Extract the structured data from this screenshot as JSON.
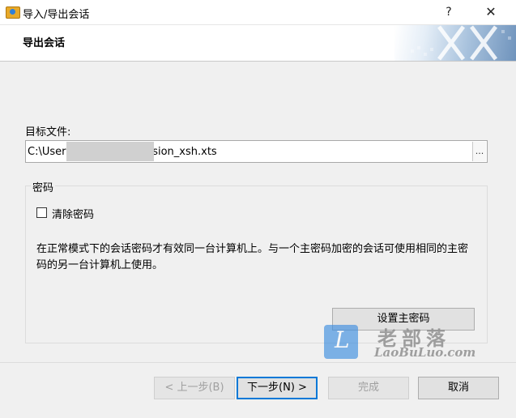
{
  "window": {
    "title": "导入/导出会话",
    "help_label": "?",
    "close_label": "✕",
    "icon": "xshell-folder-icon"
  },
  "header": {
    "title": "导出会话"
  },
  "target": {
    "label": "目标文件:",
    "value_prefix": "C:\\Users",
    "value_suffix": "op\\session_xsh.xts",
    "browse_label": "..."
  },
  "password": {
    "legend": "密码",
    "checkbox_label": "清除密码",
    "checked": false,
    "description": "在正常模式下的会话密码才有效同一台计算机上。与一个主密码加密的会话可使用相同的主密码的另一台计算机上使用。",
    "set_master_label": "设置主密码"
  },
  "watermark": {
    "logo_glyph": "L",
    "cn": "老部落",
    "en": "LaoBuLuo.com"
  },
  "footer": {
    "back_label": "< 上一步(B)",
    "next_label": "下一步(N) >",
    "finish_label": "完成",
    "cancel_label": "取消"
  },
  "colors": {
    "window_bg": "#f0f0f0",
    "accent": "#0078d7",
    "disabled_text": "#a0a0a0"
  }
}
